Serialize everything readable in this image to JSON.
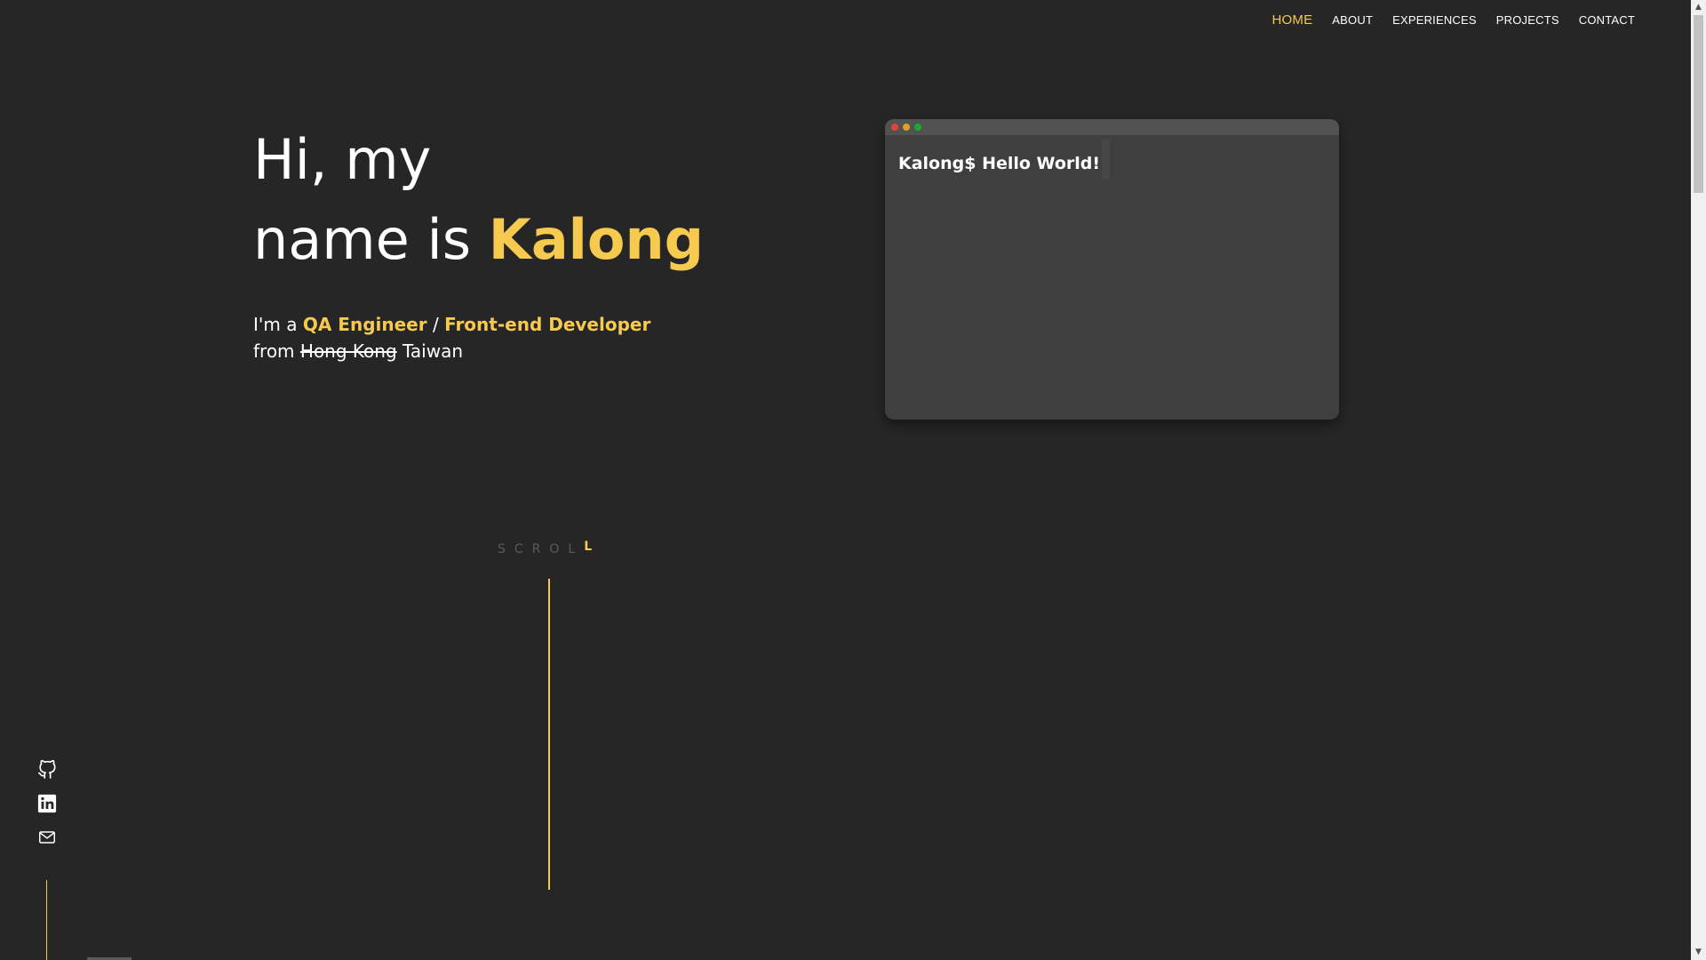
{
  "nav": {
    "items": [
      {
        "label": "HOME",
        "active": true
      },
      {
        "label": "ABOUT",
        "active": false
      },
      {
        "label": "EXPERIENCES",
        "active": false
      },
      {
        "label": "PROJECTS",
        "active": false
      },
      {
        "label": "CONTACT",
        "active": false
      }
    ]
  },
  "hero": {
    "line1": "Hi, my",
    "line2_prefix": "name is ",
    "name": "Kalong",
    "sub_prefix": "I'm a ",
    "role1": "QA Engineer",
    "separator": " / ",
    "role2": "Front-end Developer",
    "from_prefix": "from ",
    "old_location": "Hong Kong",
    "location": "Taiwan"
  },
  "terminal": {
    "text": "Kalong$ Hello World!",
    "dot_colors": [
      "#e0443e",
      "#dea123",
      "#1aab29"
    ]
  },
  "scroll": {
    "text_dim": "SCROL",
    "text_accent": "L"
  },
  "social": {
    "icons": [
      "github-icon",
      "linkedin-icon",
      "mail-icon"
    ]
  },
  "colors": {
    "accent": "#f6c94f",
    "background": "#262626",
    "terminal": "#3f3f3f"
  }
}
